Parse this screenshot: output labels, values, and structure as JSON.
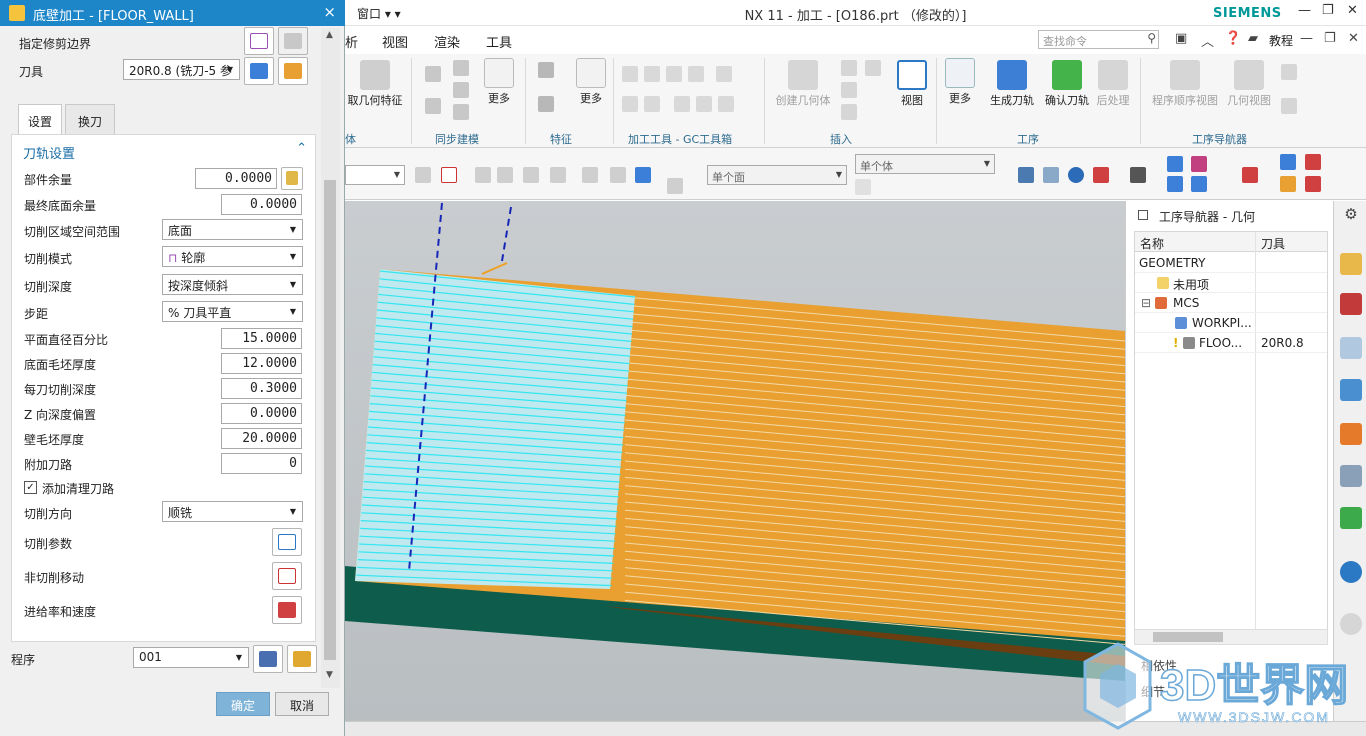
{
  "nx_window": {
    "window_menu": "窗口",
    "title": "NX 11 - 加工 - [O186.prt （修改的）]",
    "brand": "SIEMENS"
  },
  "menubar": {
    "items": [
      "析",
      "视图",
      "渲染",
      "工具"
    ],
    "search_placeholder": "查找命令",
    "tutorial": "教程"
  },
  "ribbon": {
    "buttons": {
      "extract": "取几何特征",
      "more1": "更多",
      "more2": "更多",
      "create_geometry": "创建几何体",
      "view": "视图",
      "more3": "更多",
      "generate": "生成刀轨",
      "verify": "确认刀轨",
      "postprocess": "后处理",
      "program_order": "程序顺序视图",
      "geometry_view": "几何视图"
    },
    "groups": [
      "体",
      "同步建模",
      "特征",
      "加工工具 - GC工具箱",
      "插入",
      "工序",
      "工序导航器"
    ]
  },
  "selection_bar": {
    "face_filter": "单个面",
    "body_filter": "单个体"
  },
  "navigator": {
    "title": "工序导航器 - 几何",
    "col_name": "名称",
    "col_tool": "刀具",
    "rows": [
      {
        "name": "GEOMETRY",
        "tool": ""
      },
      {
        "name": "未用项",
        "tool": ""
      },
      {
        "name": "MCS",
        "tool": ""
      },
      {
        "name": "WORKPI...",
        "tool": ""
      },
      {
        "name": "FLOO...",
        "tool": "20R0.8"
      }
    ],
    "lower_1": "相依性",
    "lower_2": "细节"
  },
  "dialog": {
    "title": "底壁加工 - [FLOOR_WALL]",
    "close": "×",
    "trim_boundary_label": "指定修剪边界",
    "tool_label": "刀具",
    "tool_value": "20R0.8 (铣刀-5 参",
    "tabs": [
      "设置",
      "换刀"
    ],
    "section": "刀轨设置",
    "fields": {
      "part_stock": {
        "label": "部件余量",
        "value": "0.0000"
      },
      "final_floor_stock": {
        "label": "最终底面余量",
        "value": "0.0000"
      },
      "cut_region": {
        "label": "切削区域空间范围",
        "value": "底面"
      },
      "cut_pattern": {
        "label": "切削模式",
        "value": "轮廓"
      },
      "cut_depth": {
        "label": "切削深度",
        "value": "按深度倾斜"
      },
      "stepover": {
        "label": "步距",
        "value": "% 刀具平直"
      },
      "flat_diameter_pct": {
        "label": "平面直径百分比",
        "value": "15.0000"
      },
      "floor_blank_thickness": {
        "label": "底面毛坯厚度",
        "value": "12.0000"
      },
      "depth_per_cut": {
        "label": "每刀切削深度",
        "value": "0.3000"
      },
      "z_depth_offset": {
        "label": "Z 向深度偏置",
        "value": "0.0000"
      },
      "wall_blank_thickness": {
        "label": "壁毛坯厚度",
        "value": "20.0000"
      },
      "additional_passes": {
        "label": "附加刀路",
        "value": "0"
      },
      "cleanup": {
        "label": "添加清理刀路",
        "checked": "✓"
      },
      "cut_direction": {
        "label": "切削方向",
        "value": "顺铣"
      },
      "cut_params": {
        "label": "切削参数"
      },
      "non_cut_moves": {
        "label": "非切削移动"
      },
      "feeds": {
        "label": "进给率和速度"
      }
    },
    "program_label": "程序",
    "program_value": "001",
    "ok": "确定",
    "cancel": "取消"
  },
  "watermark": {
    "brand": "3D世界网",
    "url": "WWW.3DSJW.COM"
  },
  "colors": {
    "title_blue": "#1c86c8",
    "toolpath_cyan": "#33e6f0",
    "toolpath_orange": "#e8a033",
    "link_blue": "#1a6ea8"
  }
}
